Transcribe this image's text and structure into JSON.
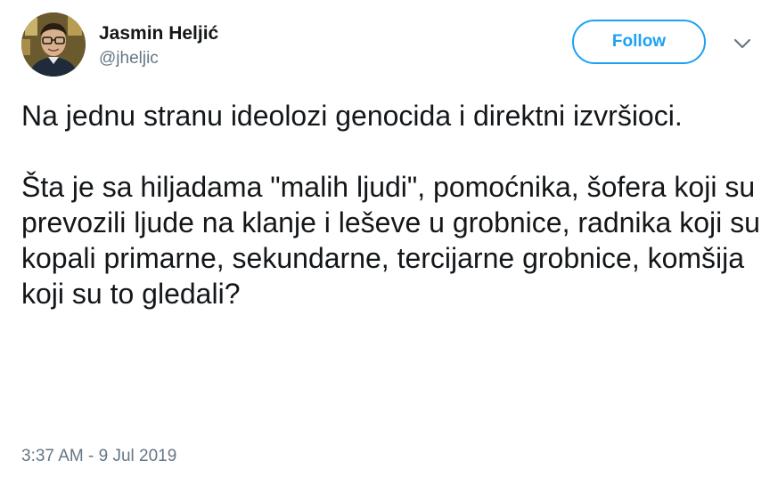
{
  "author": {
    "display_name": "Jasmin Heljić",
    "handle": "@jheljic",
    "avatar_icon": "user-photo-avatar"
  },
  "actions": {
    "follow_label": "Follow",
    "more_icon": "chevron-down-icon"
  },
  "tweet": {
    "paragraphs": [
      "Na jednu stranu ideolozi genocida i direktni izvršioci.",
      "Šta je sa hiljadama \"malih ljudi\", pomoćnika, šofera koji su prevozili ljude na klanje i leševe u grobnice, radnika koji su kopali primarne, sekundarne, tercijarne grobnice, komšija koji su to gledali?"
    ],
    "timestamp": "3:37 AM - 9 Jul 2019"
  },
  "colors": {
    "accent": "#1da1f2",
    "text_primary": "#14171a",
    "text_secondary": "#657786"
  }
}
